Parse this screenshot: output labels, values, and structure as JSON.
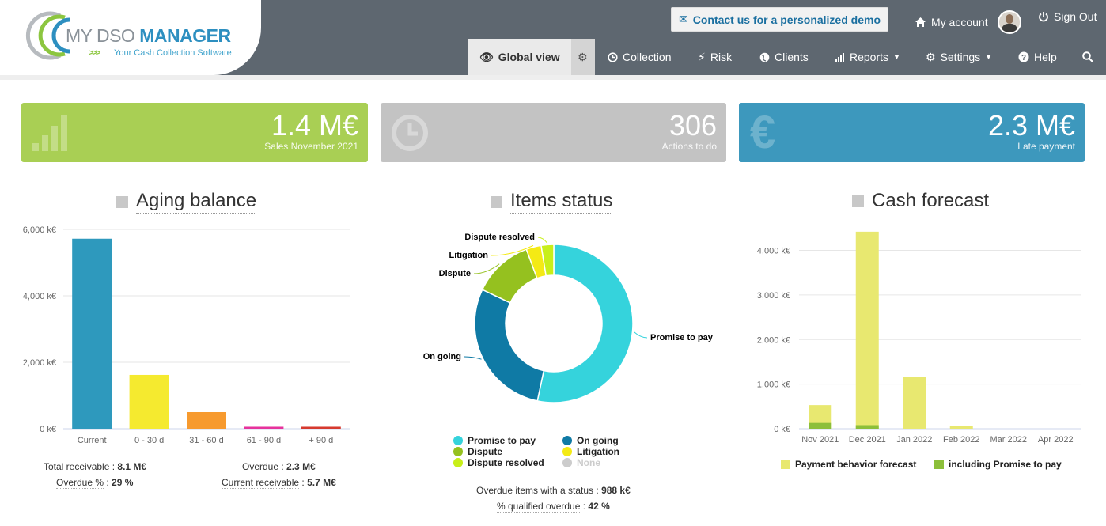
{
  "header": {
    "logo": {
      "my": "MY",
      "dso": "DSO",
      "manager": "MANAGER",
      "tagline": "Your Cash Collection Software",
      "arrows": ">>>"
    },
    "demo_button": "Contact us for a personalized demo",
    "my_account": "My account",
    "sign_out": "Sign Out",
    "nav": {
      "global_view": "Global view",
      "collection": "Collection",
      "risk": "Risk",
      "clients": "Clients",
      "reports": "Reports",
      "settings": "Settings",
      "help": "Help"
    }
  },
  "tiles": [
    {
      "value": "1.4 M€",
      "label": "Sales November 2021",
      "color": "#a9cf54"
    },
    {
      "value": "306",
      "label": "Actions to do",
      "color": "#c3c3c3"
    },
    {
      "value": "2.3 M€",
      "label": "Late payment",
      "color": "#3d98bd"
    }
  ],
  "aging": {
    "title": "Aging balance",
    "summary": {
      "total_label": "Total receivable",
      "total_value": "8.1 M€",
      "overdue_label": "Overdue",
      "overdue_value": "2.3 M€",
      "overdue_pct_label": "Overdue %",
      "overdue_pct_value": "29 %",
      "current_label": "Current receivable",
      "current_value": "5.7 M€"
    }
  },
  "items": {
    "title": "Items status",
    "legend": [
      "Promise to pay",
      "On going",
      "Dispute",
      "Litigation",
      "Dispute resolved",
      "None"
    ],
    "summary": {
      "overdue_status_label": "Overdue items with a status",
      "overdue_status_value": "988 k€",
      "qualified_label": "% qualified overdue",
      "qualified_value": "42 %"
    }
  },
  "forecast": {
    "title": "Cash forecast",
    "legend": [
      "Payment behavior forecast",
      "including Promise to pay"
    ]
  },
  "chart_data": [
    {
      "type": "bar",
      "title": "Aging balance",
      "categories": [
        "Current",
        "0 - 30 d",
        "31 - 60 d",
        "61 - 90 d",
        "+ 90 d"
      ],
      "values": [
        5720,
        1620,
        500,
        60,
        60
      ],
      "colors": [
        "#2e99bd",
        "#f5ea2f",
        "#f79a2e",
        "#e6339c",
        "#d63a2f"
      ],
      "yticks": [
        "0 k€",
        "2,000 k€",
        "4,000 k€",
        "6,000 k€"
      ],
      "ylim": [
        0,
        6000
      ],
      "grid": true
    },
    {
      "type": "pie",
      "title": "Items status",
      "labels": [
        "Promise to pay",
        "On going",
        "Dispute",
        "Litigation",
        "Dispute resolved"
      ],
      "values": [
        52,
        28,
        12,
        3,
        2.5
      ],
      "colors": [
        "#35d3dc",
        "#0f7aa5",
        "#95c11f",
        "#f4ea15",
        "#c8ef19"
      ]
    },
    {
      "type": "bar",
      "title": "Cash forecast",
      "categories": [
        "Nov 2021",
        "Dec 2021",
        "Jan 2022",
        "Feb 2022",
        "Mar 2022",
        "Apr 2022"
      ],
      "series": [
        {
          "name": "Payment behavior forecast",
          "values": [
            530,
            4420,
            1160,
            60,
            0,
            0
          ],
          "color": "#e8e870"
        },
        {
          "name": "including Promise to pay",
          "values": [
            130,
            80,
            0,
            0,
            0,
            0
          ],
          "color": "#8cbf3a"
        }
      ],
      "yticks": [
        "0 k€",
        "1,000 k€",
        "2,000 k€",
        "3,000 k€",
        "4,000 k€"
      ],
      "ylim": [
        0,
        4400
      ],
      "grid": true
    }
  ]
}
